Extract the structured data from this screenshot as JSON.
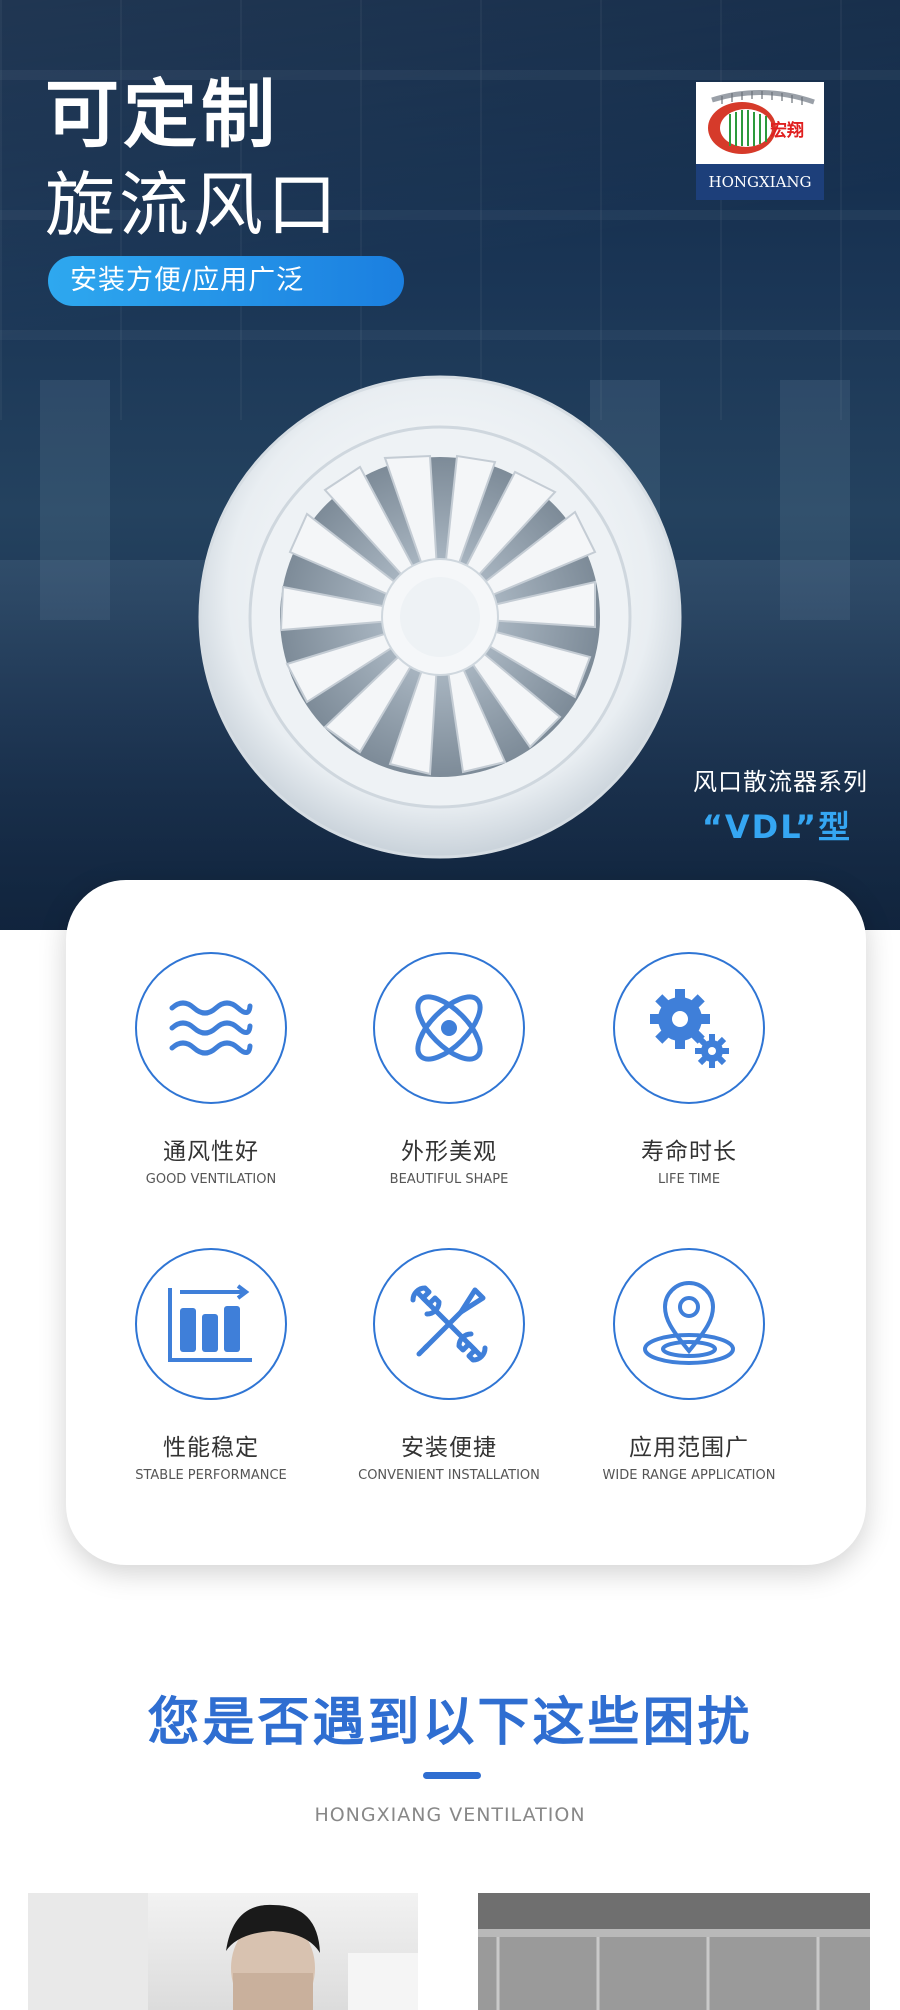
{
  "hero": {
    "title_line1": "可定制",
    "title_line2": "旋流风口",
    "pill_text": "安装方便/应用广泛",
    "series_label": "风口散流器系列",
    "model_label": "“VDL”型",
    "logo": {
      "brand_cn": "宏翔",
      "brand_en": "HONGXIANG"
    }
  },
  "features": [
    {
      "cn": "通风性好",
      "en": "GOOD VENTILATION",
      "icon": "waves-icon"
    },
    {
      "cn": "外形美观",
      "en": "BEAUTIFUL SHAPE",
      "icon": "atom-icon"
    },
    {
      "cn": "寿命时长",
      "en": "LIFE TIME",
      "icon": "gears-icon"
    },
    {
      "cn": "性能稳定",
      "en": "STABLE PERFORMANCE",
      "icon": "bar-chart-icon"
    },
    {
      "cn": "安装便捷",
      "en": "CONVENIENT INSTALLATION",
      "icon": "tools-icon"
    },
    {
      "cn": "应用范围广",
      "en": "WIDE RANGE APPLICATION",
      "icon": "location-pin-icon"
    }
  ],
  "section": {
    "title": "您是否遇到以下这些困扰",
    "subtitle": "HONGXIANG VENTILATION"
  },
  "colors": {
    "accent": "#2f6ed1",
    "pill": "#1b7fe0",
    "model": "#35a6f2",
    "hero_bg": "#1a3555"
  }
}
